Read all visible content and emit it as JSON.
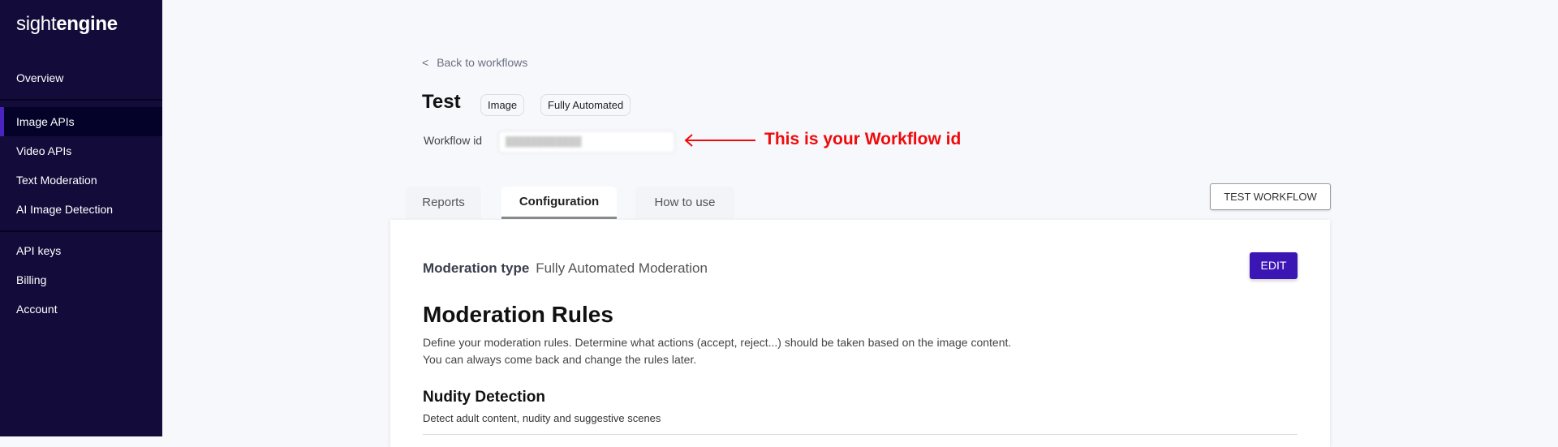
{
  "sidebar": {
    "logo": {
      "light": "sight",
      "bold": "engine"
    },
    "items": [
      {
        "label": "Overview"
      },
      {
        "label": "Image APIs",
        "active": true
      },
      {
        "label": "Video APIs"
      },
      {
        "label": "Text Moderation"
      },
      {
        "label": "AI Image Detection"
      },
      {
        "label": "API keys"
      },
      {
        "label": "Billing"
      },
      {
        "label": "Account"
      }
    ]
  },
  "header": {
    "back_icon": "<",
    "back_label": "Back to workflows",
    "title": "Test",
    "badges": [
      "Image",
      "Fully Automated"
    ],
    "workflow_id_label": "Workflow id",
    "annotation": "This is your Workflow id"
  },
  "tabs": [
    {
      "label": "Reports"
    },
    {
      "label": "Configuration",
      "active": true
    },
    {
      "label": "How to use"
    }
  ],
  "test_button": "TEST WORKFLOW",
  "config": {
    "moderation_type_label": "Moderation type",
    "moderation_type_value": "Fully Automated Moderation",
    "edit_label": "EDIT",
    "rules_title": "Moderation Rules",
    "rules_desc_1": "Define your moderation rules. Determine what actions (accept, reject...) should be taken based on the image content.",
    "rules_desc_2": "You can always come back and change the rules later.",
    "section_title": "Nudity Detection",
    "section_desc": "Detect adult content, nudity and suggestive scenes"
  },
  "colors": {
    "sidebar": "#130c3b",
    "accent": "#3b16b5",
    "annotation": "#f00a0a"
  }
}
